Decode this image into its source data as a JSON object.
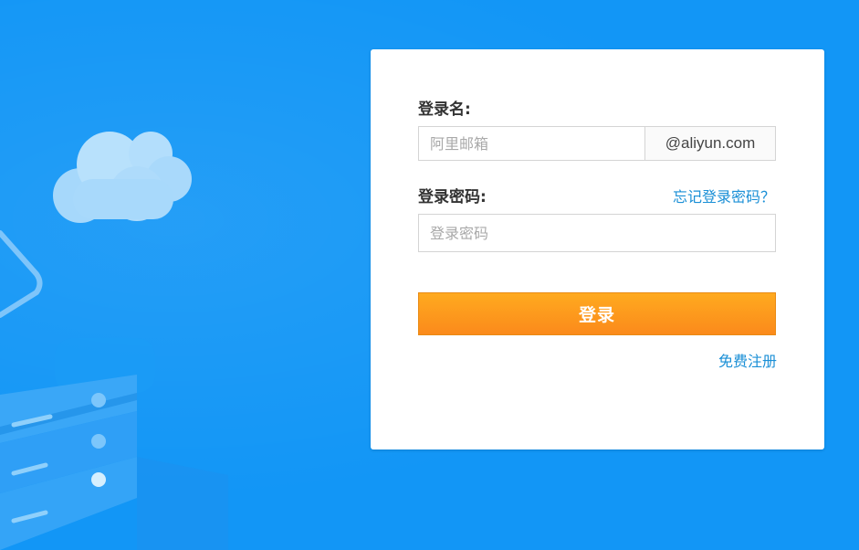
{
  "login_form": {
    "username_label": "登录名:",
    "username_placeholder": "阿里邮箱",
    "username_value": "",
    "domain_suffix": "@aliyun.com",
    "password_label": "登录密码:",
    "password_placeholder": "登录密码",
    "password_value": "",
    "forgot_password_link": "忘记登录密码？",
    "submit_label": "登录",
    "register_link": "免费注册"
  },
  "colors": {
    "background": "#1296f6",
    "button_top": "#ffaa1f",
    "button_bottom": "#fb8a1b",
    "link": "#1a8fd6"
  },
  "icons": [
    "cloud-icon",
    "server-rack-icon",
    "device-icon"
  ]
}
